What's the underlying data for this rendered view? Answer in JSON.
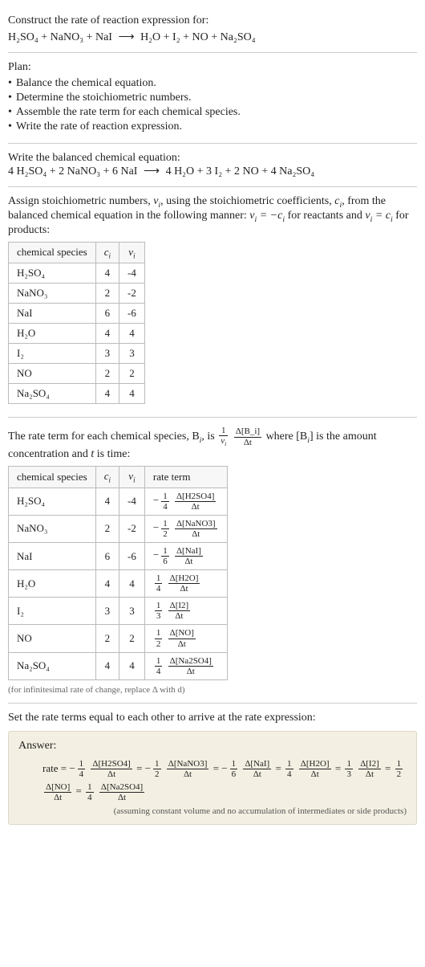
{
  "intro": {
    "line1": "Construct the rate of reaction expression for:",
    "eq_unbalanced_lhs": "H₂SO₄ + NaNO₃ + NaI",
    "eq_unbalanced_rhs": "H₂O + I₂ + NO + Na₂SO₄"
  },
  "plan": {
    "label": "Plan:",
    "items": [
      "Balance the chemical equation.",
      "Determine the stoichiometric numbers.",
      "Assemble the rate term for each chemical species.",
      "Write the rate of reaction expression."
    ]
  },
  "balanced": {
    "label": "Write the balanced chemical equation:",
    "lhs": "4 H₂SO₄ + 2 NaNO₃ + 6 NaI",
    "rhs": "4 H₂O + 3 I₂ + 2 NO + 4 Na₂SO₄"
  },
  "assign": {
    "text_a": "Assign stoichiometric numbers, ",
    "nu_i": "ν_i",
    "text_b": ", using the stoichiometric coefficients, ",
    "c_i": "c_i",
    "text_c": ", from the balanced chemical equation in the following manner: ",
    "rel1": "ν_i = −c_i",
    "text_d": " for reactants and ",
    "rel2": "ν_i = c_i",
    "text_e": " for products:"
  },
  "table1": {
    "headers": [
      "chemical species",
      "c_i",
      "ν_i"
    ],
    "rows": [
      {
        "species": "H₂SO₄",
        "c": "4",
        "nu": "-4"
      },
      {
        "species": "NaNO₃",
        "c": "2",
        "nu": "-2"
      },
      {
        "species": "NaI",
        "c": "6",
        "nu": "-6"
      },
      {
        "species": "H₂O",
        "c": "4",
        "nu": "4"
      },
      {
        "species": "I₂",
        "c": "3",
        "nu": "3"
      },
      {
        "species": "NO",
        "c": "2",
        "nu": "2"
      },
      {
        "species": "Na₂SO₄",
        "c": "4",
        "nu": "4"
      }
    ]
  },
  "rateterm_intro": {
    "a": "The rate term for each chemical species, B",
    "b": ", is ",
    "frac1_num": "1",
    "frac1_den": "ν_i",
    "frac2_num": "Δ[B_i]",
    "frac2_den": "Δt",
    "c": " where [B",
    "d": "] is the amount concentration and ",
    "t": "t",
    "e": " is time:"
  },
  "table2": {
    "headers": [
      "chemical species",
      "c_i",
      "ν_i",
      "rate term"
    ],
    "rows": [
      {
        "species": "H₂SO₄",
        "c": "4",
        "nu": "-4",
        "neg": true,
        "coef_num": "1",
        "coef_den": "4",
        "d_num": "Δ[H2SO4]",
        "d_den": "Δt"
      },
      {
        "species": "NaNO₃",
        "c": "2",
        "nu": "-2",
        "neg": true,
        "coef_num": "1",
        "coef_den": "2",
        "d_num": "Δ[NaNO3]",
        "d_den": "Δt"
      },
      {
        "species": "NaI",
        "c": "6",
        "nu": "-6",
        "neg": true,
        "coef_num": "1",
        "coef_den": "6",
        "d_num": "Δ[NaI]",
        "d_den": "Δt"
      },
      {
        "species": "H₂O",
        "c": "4",
        "nu": "4",
        "neg": false,
        "coef_num": "1",
        "coef_den": "4",
        "d_num": "Δ[H2O]",
        "d_den": "Δt"
      },
      {
        "species": "I₂",
        "c": "3",
        "nu": "3",
        "neg": false,
        "coef_num": "1",
        "coef_den": "3",
        "d_num": "Δ[I2]",
        "d_den": "Δt"
      },
      {
        "species": "NO",
        "c": "2",
        "nu": "2",
        "neg": false,
        "coef_num": "1",
        "coef_den": "2",
        "d_num": "Δ[NO]",
        "d_den": "Δt"
      },
      {
        "species": "Na₂SO₄",
        "c": "4",
        "nu": "4",
        "neg": false,
        "coef_num": "1",
        "coef_den": "4",
        "d_num": "Δ[Na2SO4]",
        "d_den": "Δt"
      }
    ],
    "note": "(for infinitesimal rate of change, replace Δ with d)"
  },
  "set_equal": "Set the rate terms equal to each other to arrive at the rate expression:",
  "answer": {
    "label": "Answer:",
    "prefix": "rate = ",
    "terms": [
      {
        "neg": true,
        "cn": "1",
        "cd": "4",
        "dn": "Δ[H2SO4]",
        "dd": "Δt"
      },
      {
        "neg": true,
        "cn": "1",
        "cd": "2",
        "dn": "Δ[NaNO3]",
        "dd": "Δt"
      },
      {
        "neg": true,
        "cn": "1",
        "cd": "6",
        "dn": "Δ[NaI]",
        "dd": "Δt"
      },
      {
        "neg": false,
        "cn": "1",
        "cd": "4",
        "dn": "Δ[H2O]",
        "dd": "Δt"
      },
      {
        "neg": false,
        "cn": "1",
        "cd": "3",
        "dn": "Δ[I2]",
        "dd": "Δt"
      },
      {
        "neg": false,
        "cn": "1",
        "cd": "2",
        "dn": "Δ[NO]",
        "dd": "Δt"
      },
      {
        "neg": false,
        "cn": "1",
        "cd": "4",
        "dn": "Δ[Na2SO4]",
        "dd": "Δt"
      }
    ],
    "note": "(assuming constant volume and no accumulation of intermediates or side products)"
  }
}
